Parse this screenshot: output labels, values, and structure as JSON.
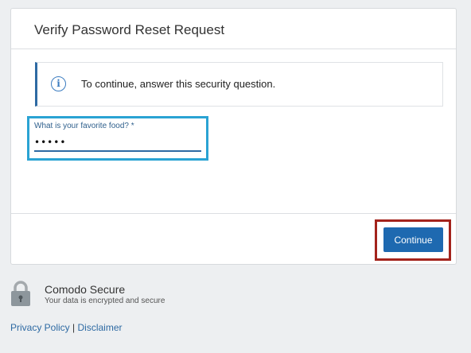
{
  "card": {
    "title": "Verify Password Reset Request",
    "info_text": "To continue, answer this security question.",
    "field": {
      "label": "What is your favorite food? *",
      "value": "•••••"
    },
    "continue_label": "Continue"
  },
  "footer": {
    "secure_title": "Comodo Secure",
    "secure_subtitle": "Your data is encrypted and secure",
    "privacy_link": "Privacy Policy",
    "separator": "|",
    "disclaimer_link": "Disclaimer"
  },
  "icons": {
    "info": "info-icon",
    "lock": "lock-icon"
  },
  "colors": {
    "accent": "#1e69b0",
    "field_highlight": "#2aa3d3",
    "button_highlight": "#a3231c"
  }
}
